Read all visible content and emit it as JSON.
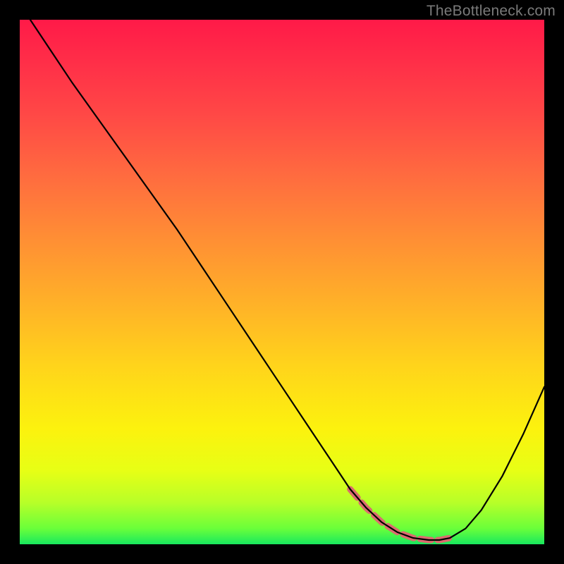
{
  "watermark": "TheBottleneck.com",
  "chart_data": {
    "type": "line",
    "title": "",
    "xlabel": "",
    "ylabel": "",
    "xlim": [
      0,
      100
    ],
    "ylim": [
      0,
      100
    ],
    "series": [
      {
        "name": "main-curve",
        "x": [
          2,
          6,
          10,
          15,
          20,
          25,
          30,
          35,
          40,
          45,
          50,
          55,
          60,
          63,
          66,
          69,
          72,
          75,
          78,
          80,
          82,
          85,
          88,
          92,
          96,
          100
        ],
        "values": [
          100,
          94,
          88,
          81,
          74,
          67,
          60,
          52.5,
          45,
          37.5,
          30,
          22.5,
          15,
          10.5,
          7,
          4.2,
          2.3,
          1.2,
          0.8,
          0.8,
          1.2,
          3,
          6.5,
          13,
          21,
          30
        ]
      },
      {
        "name": "highlight-segment",
        "x": [
          63,
          66,
          69,
          72,
          75,
          78,
          80,
          82
        ],
        "values": [
          10.5,
          7,
          4.2,
          2.3,
          1.2,
          0.8,
          0.8,
          1.2
        ]
      }
    ],
    "colors": {
      "curve": "#000000",
      "highlight": "#db6b6e",
      "gradient_top": "#ff1a48",
      "gradient_bottom": "#18e85e"
    }
  }
}
